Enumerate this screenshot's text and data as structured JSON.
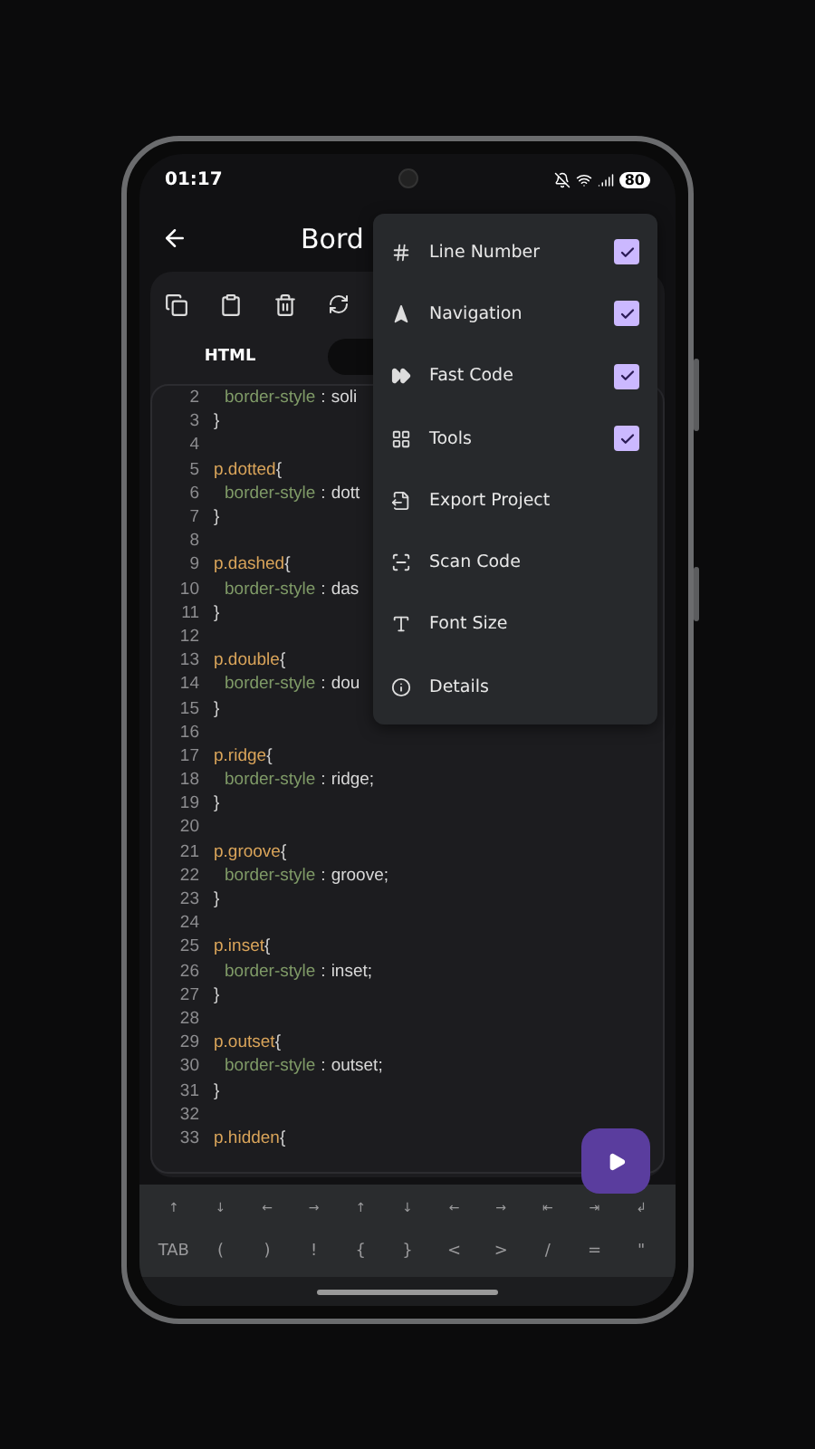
{
  "status_bar": {
    "time": "01:17",
    "battery": "80"
  },
  "app_bar": {
    "title": "Bord"
  },
  "tabs": [
    {
      "label": "HTML",
      "selected": false
    },
    {
      "selected": true
    }
  ],
  "code_lines": [
    {
      "kind": "decl",
      "number": "2",
      "property": "border-style",
      "colon": ":",
      "value": "soli"
    },
    {
      "kind": "close",
      "number": "3",
      "brace": "}"
    },
    {
      "kind": "blank",
      "number": "4"
    },
    {
      "kind": "rule",
      "number": "5",
      "selector": "p.dotted",
      "brace": "{"
    },
    {
      "kind": "decl",
      "number": "6",
      "property": "border-style",
      "colon": ":",
      "value": "dott"
    },
    {
      "kind": "close",
      "number": "7",
      "brace": "}"
    },
    {
      "kind": "blank",
      "number": "8"
    },
    {
      "kind": "rule",
      "number": "9",
      "selector": "p.dashed",
      "brace": "{"
    },
    {
      "kind": "decl",
      "number": "10",
      "property": "border-style",
      "colon": ":",
      "value": "das"
    },
    {
      "kind": "close",
      "number": "11",
      "brace": "}"
    },
    {
      "kind": "blank",
      "number": "12"
    },
    {
      "kind": "rule",
      "number": "13",
      "selector": "p.double",
      "brace": "{"
    },
    {
      "kind": "decl",
      "number": "14",
      "property": "border-style",
      "colon": ":",
      "value": "dou"
    },
    {
      "kind": "close",
      "number": "15",
      "brace": "}"
    },
    {
      "kind": "blank",
      "number": "16"
    },
    {
      "kind": "rule",
      "number": "17",
      "selector": "p.ridge",
      "brace": "{"
    },
    {
      "kind": "decl",
      "number": "18",
      "property": "border-style",
      "colon": ":",
      "value": "ridge;"
    },
    {
      "kind": "close",
      "number": "19",
      "brace": "}"
    },
    {
      "kind": "blank",
      "number": "20"
    },
    {
      "kind": "rule",
      "number": "21",
      "selector": "p.groove",
      "brace": "{"
    },
    {
      "kind": "decl",
      "number": "22",
      "property": "border-style",
      "colon": ":",
      "value": "groove;"
    },
    {
      "kind": "close",
      "number": "23",
      "brace": "}"
    },
    {
      "kind": "blank",
      "number": "24"
    },
    {
      "kind": "rule",
      "number": "25",
      "selector": "p.inset",
      "brace": "{"
    },
    {
      "kind": "decl",
      "number": "26",
      "property": "border-style",
      "colon": ":",
      "value": "inset;"
    },
    {
      "kind": "close",
      "number": "27",
      "brace": "}"
    },
    {
      "kind": "blank",
      "number": "28"
    },
    {
      "kind": "rule",
      "number": "29",
      "selector": "p.outset",
      "brace": "{"
    },
    {
      "kind": "decl",
      "number": "30",
      "property": "border-style",
      "colon": ":",
      "value": "outset;"
    },
    {
      "kind": "close",
      "number": "31",
      "brace": "}"
    },
    {
      "kind": "blank",
      "number": "32"
    },
    {
      "kind": "rule",
      "number": "33",
      "selector": "p.hidden",
      "brace": "{"
    }
  ],
  "menu": [
    {
      "kind": "check",
      "label": "Line Number",
      "checked": true
    },
    {
      "kind": "check",
      "label": "Navigation",
      "checked": true
    },
    {
      "kind": "check",
      "label": "Fast Code",
      "checked": true
    },
    {
      "kind": "check",
      "label": "Tools",
      "checked": true
    },
    {
      "kind": "action",
      "label": "Export Project"
    },
    {
      "kind": "action",
      "label": "Scan Code"
    },
    {
      "kind": "action",
      "label": "Font Size"
    },
    {
      "kind": "action",
      "label": "Details"
    }
  ],
  "keys": [
    [
      "↑",
      "↓",
      "←",
      "→",
      "↑",
      "↓",
      "←",
      "→",
      "⇤",
      "⇥",
      "↲"
    ],
    [
      "TAB",
      "(",
      ")",
      "!",
      "{",
      "}",
      "<",
      ">",
      "/",
      "=",
      "\""
    ]
  ]
}
